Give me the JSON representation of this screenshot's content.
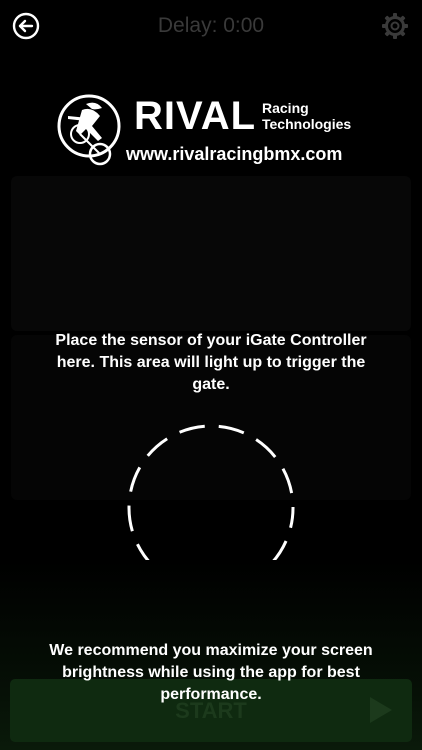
{
  "header": {
    "delay_text": "Delay: 0:00",
    "back_icon": "back-arrow-icon",
    "settings_icon": "gear-icon"
  },
  "logo": {
    "brand": "RIVAL",
    "tagline_line1": "Racing",
    "tagline_line2": "Technologies",
    "url": "www.rivalracingbmx.com"
  },
  "sensor": {
    "instruction": "Place the sensor of your iGate Controller here. This area will light up to trigger the gate."
  },
  "footer": {
    "recommendation": "We recommend you maximize your screen brightness while using the app for best performance.",
    "start_label": "START",
    "play_icon": "play-icon"
  },
  "colors": {
    "background": "#000000",
    "delay_text": "#3a3a3a",
    "start_button_bg": "#0f2a10",
    "start_label": "#1c3a1c"
  }
}
